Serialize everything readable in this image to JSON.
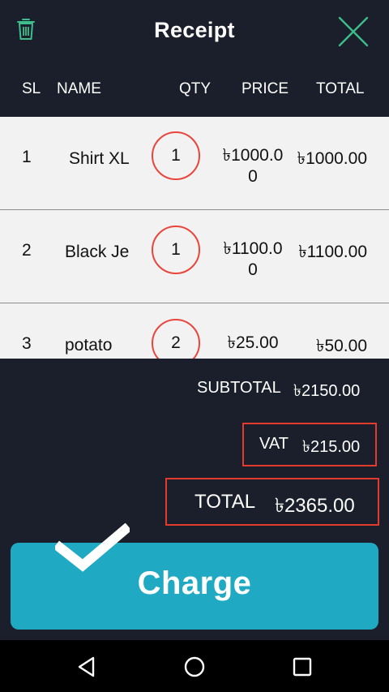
{
  "header": {
    "title": "Receipt",
    "left_icon": "trash-icon",
    "right_icon": "close-icon",
    "accent": "#3dbd8a"
  },
  "columns": {
    "sl": "SL",
    "name": "NAME",
    "qty": "QTY",
    "price": "PRICE",
    "total": "TOTAL"
  },
  "items": [
    {
      "sl": "1",
      "name": "Shirt XL",
      "qty": "1",
      "price_line1": "৳1000.0",
      "price_line2": "0",
      "total": "৳1000.00"
    },
    {
      "sl": "2",
      "name": "Black Je",
      "qty": "1",
      "price_line1": "৳1100.0",
      "price_line2": "0",
      "total": "৳1100.00"
    },
    {
      "sl": "3",
      "name": "potato",
      "qty": "2",
      "price_line1": "৳25.00",
      "price_line2": "",
      "total": "৳50.00"
    }
  ],
  "summary": {
    "subtotal_label": "SUBTOTAL",
    "subtotal_value": "৳2150.00",
    "vat_label": "VAT",
    "vat_value": "৳215.00",
    "total_label": "TOTAL",
    "total_value": "৳2365.00"
  },
  "charge": {
    "label": "Charge",
    "color": "#1fa9c3"
  },
  "navbar": {
    "icons": [
      "back-icon",
      "home-icon",
      "recents-icon"
    ]
  },
  "colors": {
    "background": "#1b1f2b",
    "highlight": "#e23b2e"
  }
}
